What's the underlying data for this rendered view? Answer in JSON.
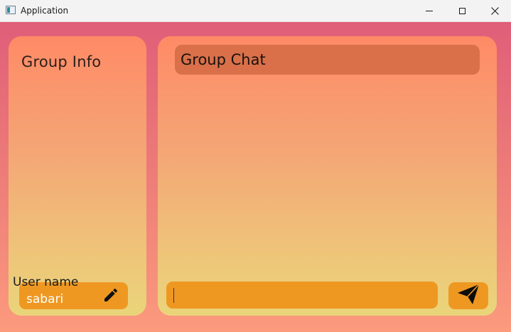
{
  "window": {
    "title": "Application"
  },
  "left_panel": {
    "title": "Group Info",
    "username_label": "User name",
    "username_value": "sabari",
    "edit_icon": "pencil-icon"
  },
  "right_panel": {
    "title": "Group Chat",
    "message_input": {
      "value": "",
      "placeholder": ""
    },
    "send_icon": "paper-plane-icon"
  },
  "colors": {
    "background_top": "#e05e79",
    "background_bottom": "#fb9a7d",
    "panel_top": "#ff8a66",
    "panel_bottom": "#ead57a",
    "chat_header": "#d9704a",
    "input_fill": "#ee9822"
  }
}
